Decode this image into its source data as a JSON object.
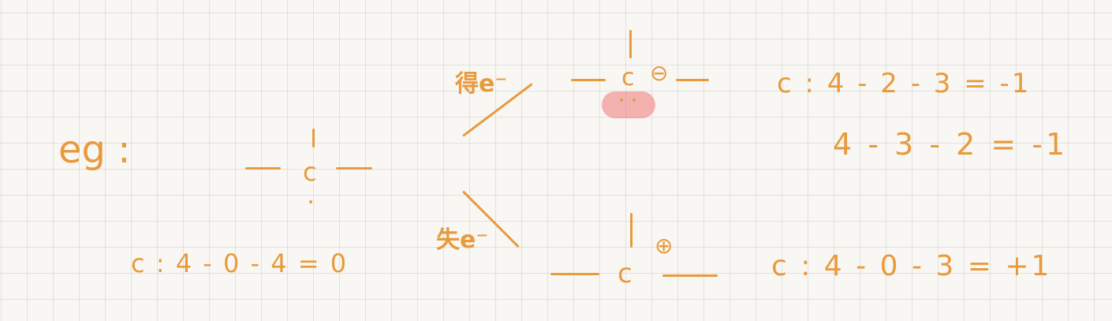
{
  "note": {
    "eg_label": "eg :",
    "center": {
      "atom": "c",
      "formula": "c : 4 - 0 - 4 = 0"
    },
    "gain_branch": {
      "label": "得e⁻",
      "atom": "c",
      "charge": "⊖",
      "formula_1": "c : 4 - 2 - 3 = -1",
      "formula_2": "4 - 3 - 2 = -1"
    },
    "lose_branch": {
      "label": "失e⁻",
      "atom": "c",
      "charge": "⊕",
      "formula": "c : 4 - 0 - 3 = +1"
    },
    "colors": {
      "ink": "#e99a3c",
      "highlight": "#ee7878",
      "grid": "#cfcfcf",
      "paper": "#f8f7f4"
    }
  }
}
